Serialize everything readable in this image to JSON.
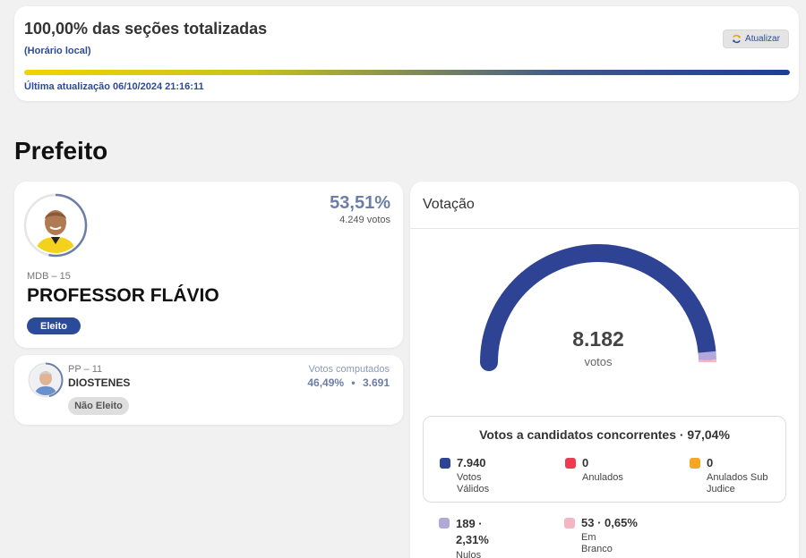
{
  "status": {
    "title": "100,00% das seções totalizadas",
    "subtitle": "(Horário local)",
    "progress_pct": 100,
    "last_update": "Última atualização 06/10/2024 21:16:11",
    "refresh_label": "Atualizar"
  },
  "section_title": "Prefeito",
  "winner": {
    "party": "MDB – 15",
    "name": "PROFESSOR FLÁVIO",
    "pct": "53,51%",
    "votes": "4.249 votos",
    "badge": "Eleito",
    "ring_fraction": 0.5351
  },
  "loser": {
    "party": "PP – 11",
    "name": "DIOSTENES",
    "computed_label": "Votos computados",
    "pct": "46,49%",
    "separator": "•",
    "votes": "3.691",
    "badge": "Não Eleito",
    "ring_fraction": 0.4649
  },
  "voting": {
    "title": "Votação",
    "total": "8.182",
    "total_label": "votos",
    "gauge": {
      "valid_fraction": 0.9704,
      "nulos_fraction": 0.0231,
      "branco_fraction": 0.0065
    },
    "valid_box_title": "Votos a candidatos concorrentes · 97,04%",
    "stats": {
      "validos": {
        "value": "7.940",
        "label": "Votos Válidos",
        "color": "#2e4394"
      },
      "anulados": {
        "value": "0",
        "label": "Anulados",
        "color": "#ee3b52"
      },
      "sub_judice": {
        "value": "0",
        "label": "Anulados Sub Judice",
        "color": "#f5a623"
      },
      "nulos": {
        "value": "189 · 2,31%",
        "label": "Nulos",
        "color": "#b3a9d8"
      },
      "branco": {
        "value": "53 · 0,65%",
        "label": "Em Branco",
        "color": "#f4b6c2"
      }
    }
  }
}
